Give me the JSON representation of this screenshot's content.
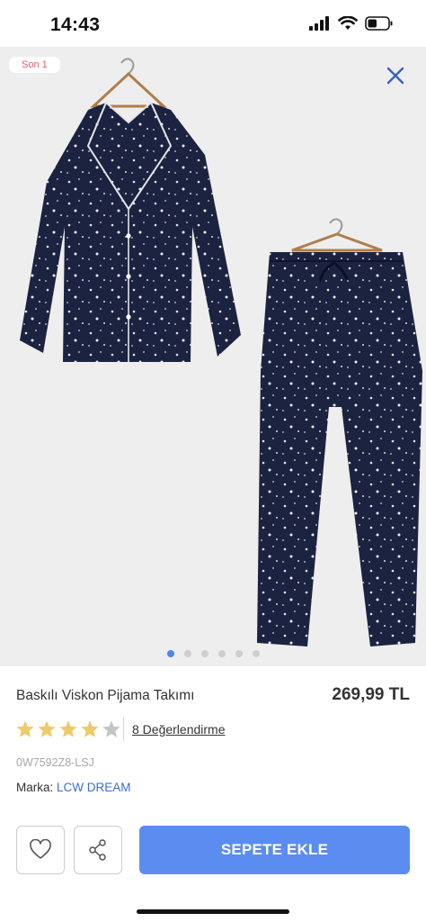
{
  "status": {
    "time": "14:43",
    "battery_level": 0.45
  },
  "gallery": {
    "badge": "Son 1",
    "image_count": 6,
    "active_index": 0,
    "close_icon": "close-icon"
  },
  "product": {
    "title": "Baskılı Viskon Pijama Takımı",
    "price": "269,99 TL",
    "rating": 4,
    "rating_max": 5,
    "reviews_label": "8 Değerlendirme",
    "sku": "0W7592Z8-LSJ",
    "brand_label": "Marka:",
    "brand_name": "LCW DREAM"
  },
  "actions": {
    "favorite_icon": "heart-icon",
    "share_icon": "share-icon",
    "add_to_cart": "SEPETE EKLE"
  },
  "colors": {
    "accent": "#5a8def",
    "star_filled": "#f0c96a",
    "star_empty": "#c4c4c4",
    "badge_text": "#e05b6b",
    "garment": "#1c2340"
  }
}
